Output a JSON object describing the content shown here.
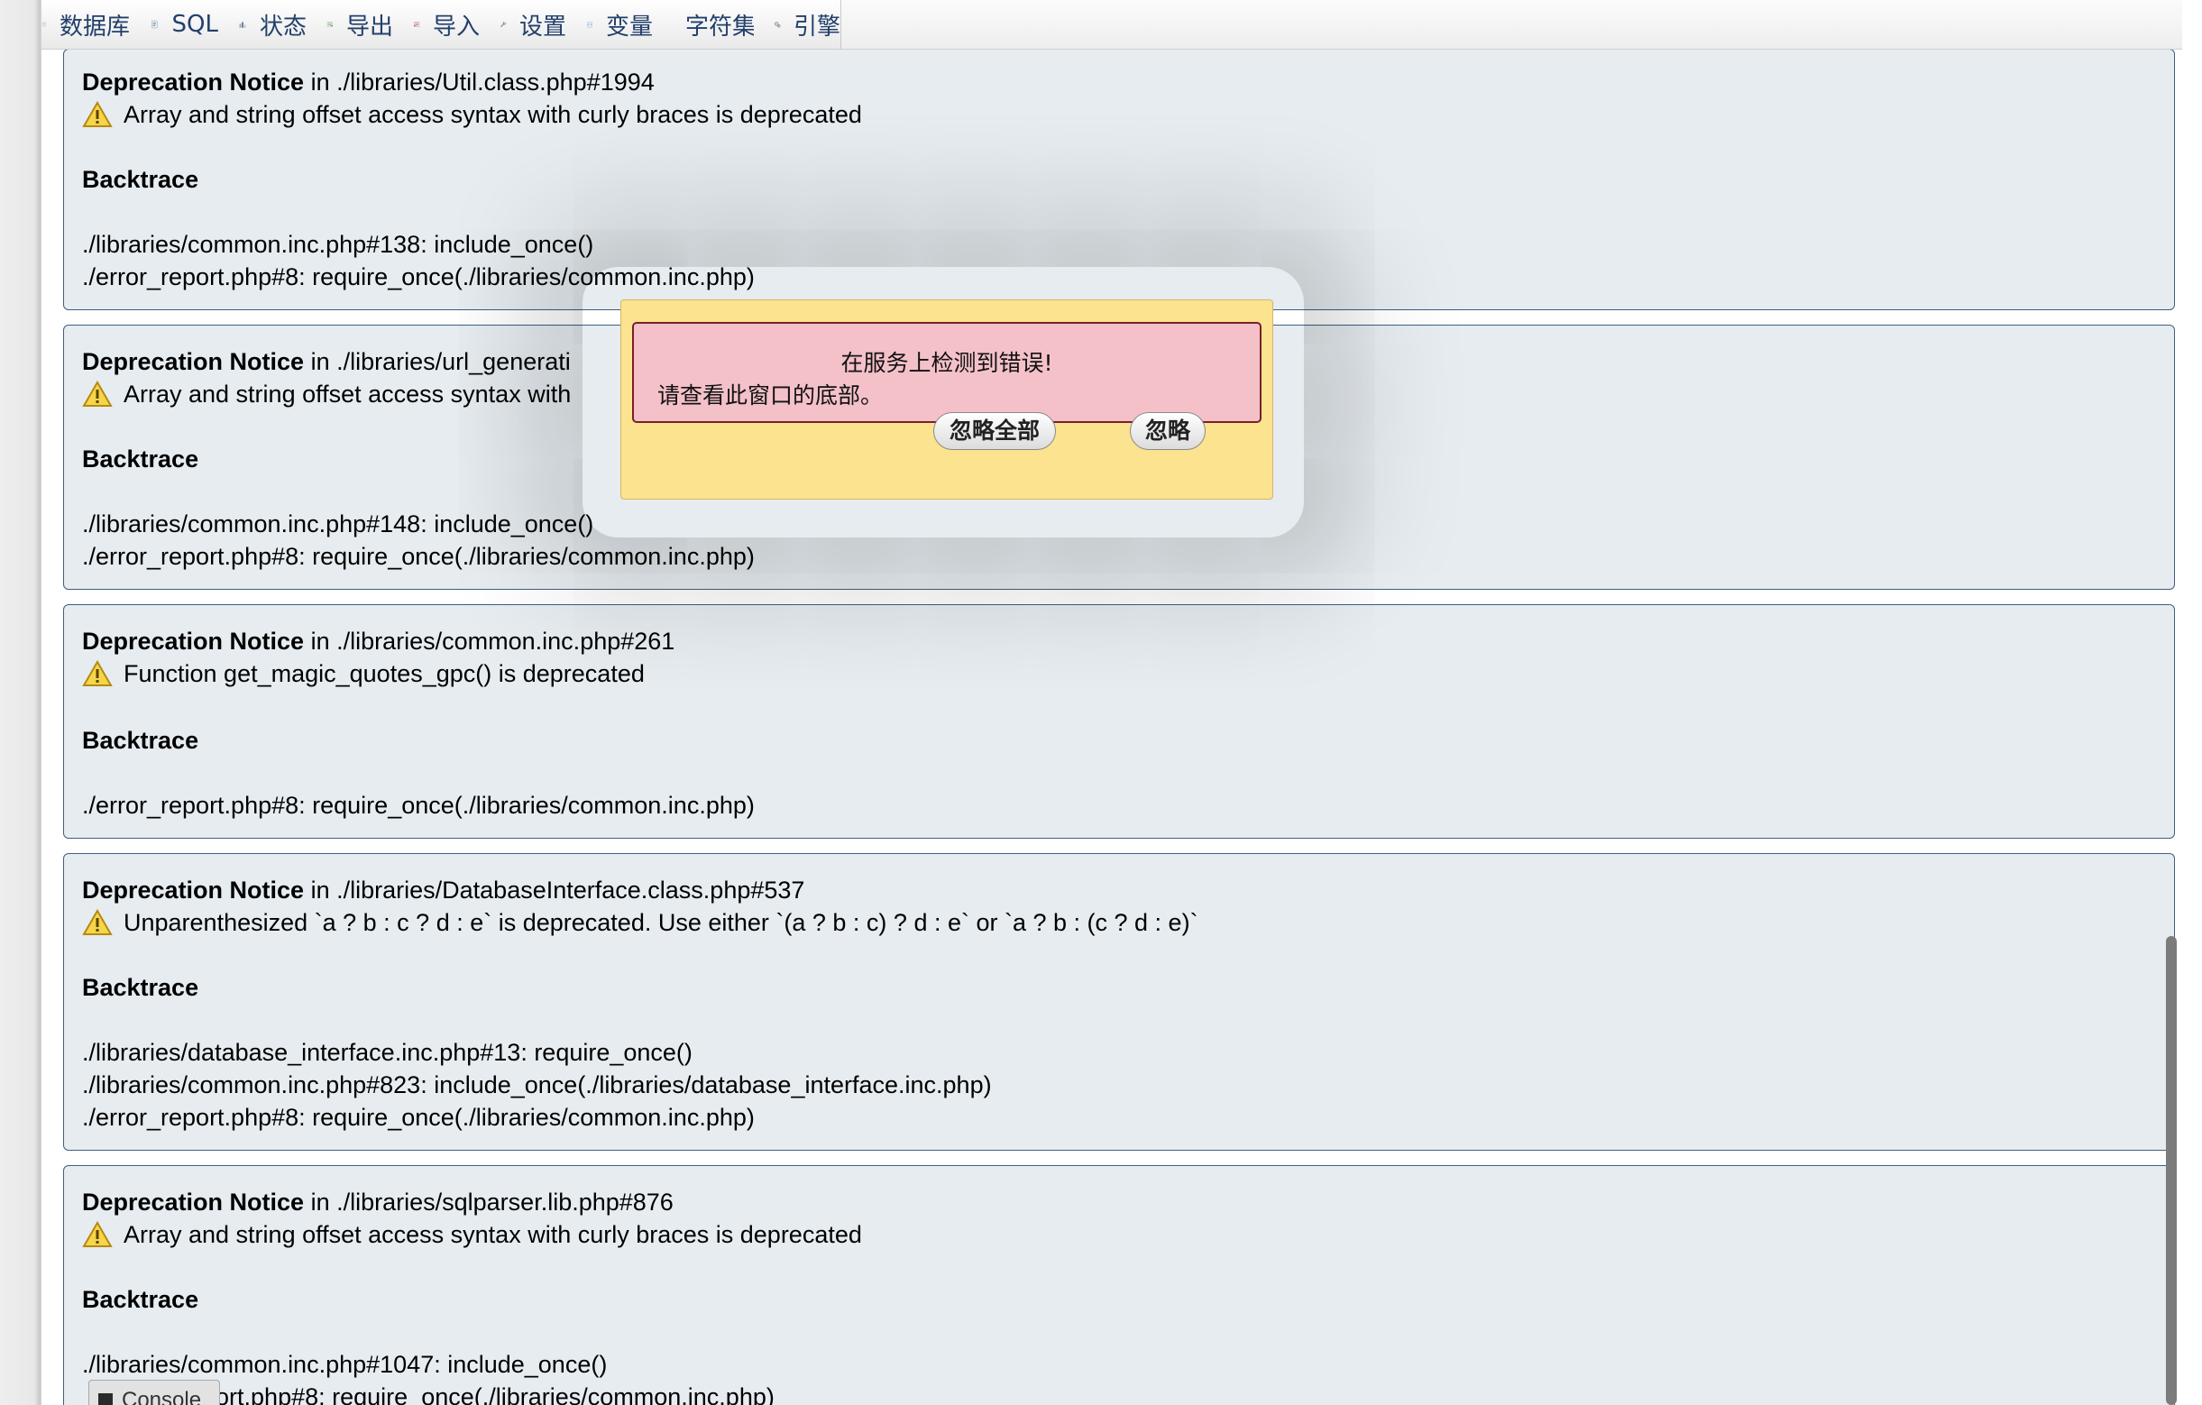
{
  "tabs": [
    {
      "label": "数据库",
      "icon": "database-icon"
    },
    {
      "label": "SQL",
      "icon": "sql-icon"
    },
    {
      "label": "状态",
      "icon": "status-icon"
    },
    {
      "label": "导出",
      "icon": "export-icon"
    },
    {
      "label": "导入",
      "icon": "import-icon"
    },
    {
      "label": "设置",
      "icon": "wrench-icon"
    },
    {
      "label": "变量",
      "icon": "variables-icon"
    },
    {
      "label": "字符集",
      "icon": "charset-icon"
    },
    {
      "label": "引擎",
      "icon": "engine-icon"
    }
  ],
  "notice_strings": {
    "title": "Deprecation Notice",
    "in": "in",
    "backtrace": "Backtrace"
  },
  "notices": [
    {
      "location": "./libraries/Util.class.php#1994",
      "message": "Array and string offset access syntax with curly braces is deprecated",
      "trace": [
        "./libraries/common.inc.php#138: include_once()",
        "./error_report.php#8: require_once(./libraries/common.inc.php)"
      ]
    },
    {
      "location": "./libraries/url_generati",
      "message": "Array and string offset access syntax with",
      "trace": [
        "./libraries/common.inc.php#148: include_once()",
        "./error_report.php#8: require_once(./libraries/common.inc.php)"
      ]
    },
    {
      "location": "./libraries/common.inc.php#261",
      "message": "Function get_magic_quotes_gpc() is deprecated",
      "trace": [
        "./error_report.php#8: require_once(./libraries/common.inc.php)"
      ]
    },
    {
      "location": "./libraries/DatabaseInterface.class.php#537",
      "message": "Unparenthesized `a ? b : c ? d : e` is deprecated. Use either `(a ? b : c) ? d : e` or `a ? b : (c ? d : e)`",
      "trace": [
        "./libraries/database_interface.inc.php#13: require_once()",
        "./libraries/common.inc.php#823: include_once(./libraries/database_interface.inc.php)",
        "./error_report.php#8: require_once(./libraries/common.inc.php)"
      ]
    },
    {
      "location": "./libraries/sqlparser.lib.php#876",
      "message": "Array and string offset access syntax with curly braces is deprecated",
      "trace": [
        "./libraries/common.inc.php#1047: include_once()",
        "eport.php#8: require_once(./libraries/common.inc.php)"
      ]
    }
  ],
  "modal": {
    "line1": "在服务上检测到错误!",
    "line2": "请查看此窗口的底部。",
    "ignore_all_label": "忽略全部",
    "ignore_label": "忽略"
  },
  "console": {
    "label": "Console"
  },
  "colors": {
    "notice_bg": "#e6ecf0",
    "notice_border": "#3f5f7e",
    "modal_bg": "#fbe38f",
    "modal_msg_bg": "#f4c1c8",
    "tab_text": "#23406b"
  }
}
